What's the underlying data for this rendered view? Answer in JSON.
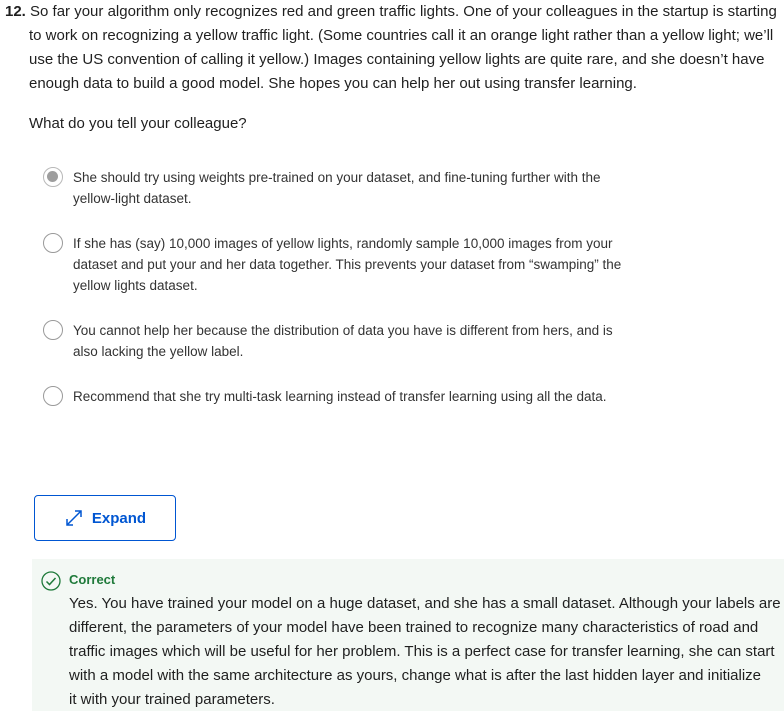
{
  "question": {
    "number": "12.",
    "lines": [
      "So far your algorithm only recognizes red and green traffic lights. One of your colleagues in the startup is starting",
      "to work on recognizing a yellow traffic light. (Some countries call it an orange light rather than a yellow light; we’ll",
      "use the US convention of calling it yellow.) Images containing yellow lights are quite rare, and she doesn’t have",
      "enough data to build a good model. She hopes you can help her out using transfer learning."
    ],
    "prompt": "What do you tell your colleague?"
  },
  "options": [
    {
      "selected": true,
      "lines": [
        "She should try using weights pre-trained on your dataset, and fine-tuning further with the",
        "yellow-light dataset."
      ]
    },
    {
      "selected": false,
      "lines": [
        "If she has (say) 10,000 images of yellow lights, randomly sample 10,000 images from your",
        "dataset and put your and her data together. This prevents your dataset from “swamping” the",
        "yellow lights dataset."
      ]
    },
    {
      "selected": false,
      "lines": [
        "You cannot help her because the distribution of data you have is different from hers, and is",
        "also lacking the yellow label."
      ]
    },
    {
      "selected": false,
      "lines": [
        "Recommend that she try multi-task learning instead of transfer learning using all the data."
      ]
    }
  ],
  "expand_button": {
    "label": "Expand",
    "icon": "expand-arrows-icon"
  },
  "feedback": {
    "status": "Correct",
    "icon": "check-circle-icon",
    "status_color": "#1f7a3a",
    "lines": [
      "Yes. You have trained your model on a huge dataset, and she has a small dataset. Although your labels are",
      "different, the parameters of your model have been trained to recognize many characteristics of road and",
      "traffic images which will be useful for her problem. This is a perfect case for transfer learning, she can start",
      "with a model with the same architecture as yours, change what is after the last hidden layer and initialize",
      "it with your trained parameters."
    ]
  },
  "colors": {
    "accent": "#0056d2",
    "feedback_bg": "#f3f8f4"
  }
}
